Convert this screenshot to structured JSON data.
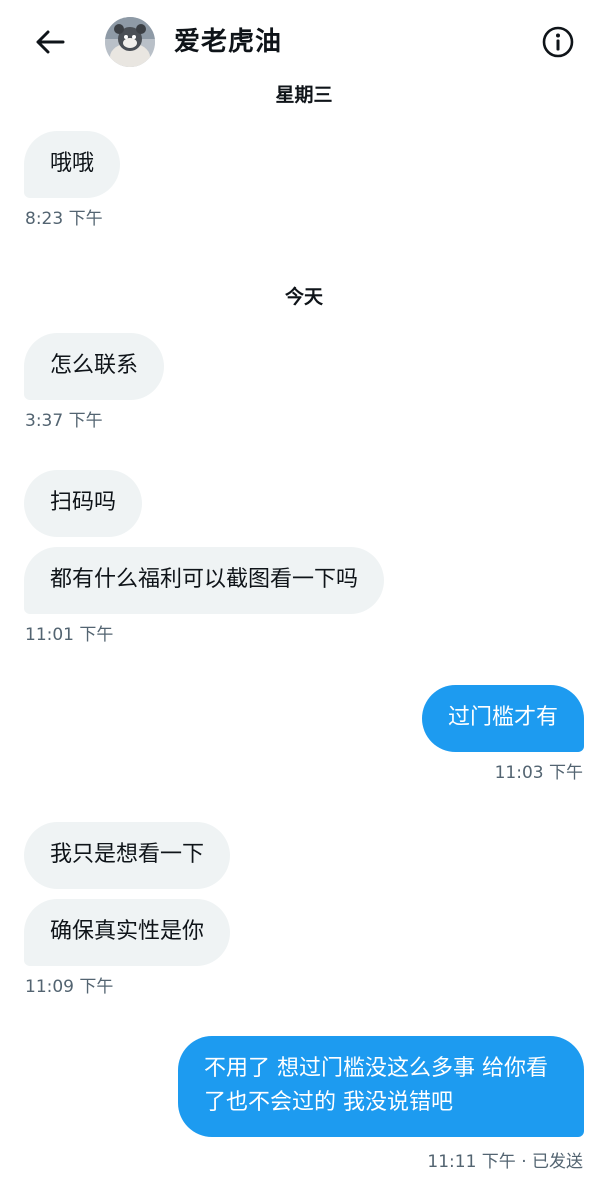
{
  "header": {
    "back_icon": "arrow-left-icon",
    "contact_name": "爱老虎油",
    "info_icon": "info-circle-icon"
  },
  "messages": {
    "date_wed": "星期三",
    "m1": "哦哦",
    "t1": "8:23 下午",
    "date_today": "今天",
    "m2": "怎么联系",
    "t2": "3:37 下午",
    "m3": "扫码吗",
    "m4": "都有什么福利可以截图看一下吗",
    "t3": "11:01 下午",
    "m5": "过门槛才有",
    "t4": "11:03 下午",
    "m6": "我只是想看一下",
    "m7": "确保真实性是你",
    "t5": "11:09 下午",
    "m8": "不用了 想过门槛没这么多事 给你看\n了也不会过的 我没说错吧",
    "t6": "11:11 下午 · 已发送"
  },
  "colors": {
    "outgoing_bubble": "#1d9bf0",
    "incoming_bubble": "#eff3f4",
    "timestamp": "#536471"
  }
}
